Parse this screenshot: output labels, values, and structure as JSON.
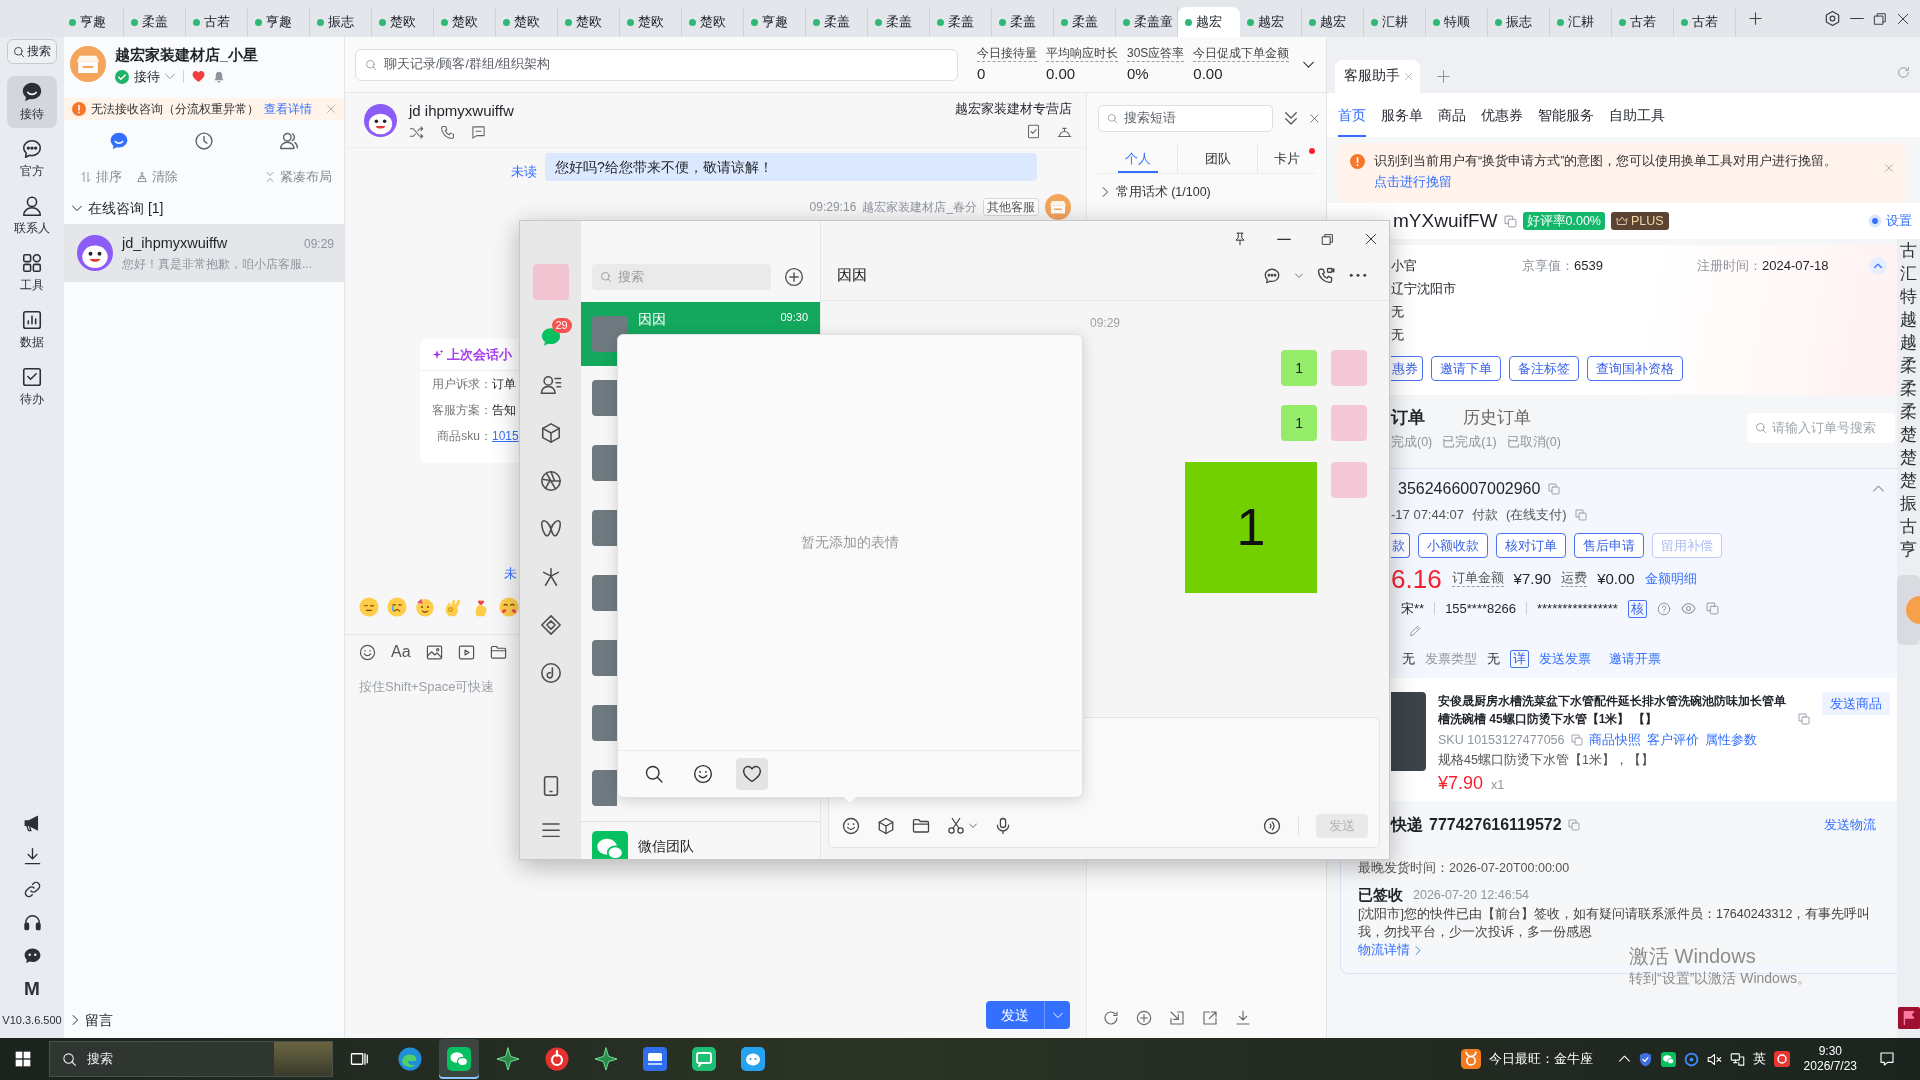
{
  "top_tabs": [
    {
      "label": "亨趣",
      "selected": false
    },
    {
      "label": "柔盖",
      "selected": false
    },
    {
      "label": "古若",
      "selected": false
    },
    {
      "label": "亨趣",
      "selected": false
    },
    {
      "label": "振志",
      "selected": false
    },
    {
      "label": "楚欧",
      "selected": false
    },
    {
      "label": "楚欧",
      "selected": false
    },
    {
      "label": "楚欧",
      "selected": false
    },
    {
      "label": "楚欧",
      "selected": false
    },
    {
      "label": "楚欧",
      "selected": false
    },
    {
      "label": "楚欧",
      "selected": false
    },
    {
      "label": "亨趣",
      "selected": false
    },
    {
      "label": "柔盖",
      "selected": false
    },
    {
      "label": "柔盖",
      "selected": false
    },
    {
      "label": "柔盖",
      "selected": false
    },
    {
      "label": "柔盖",
      "selected": false
    },
    {
      "label": "柔盖",
      "selected": false
    },
    {
      "label": "柔盖童",
      "selected": false
    },
    {
      "label": "越宏",
      "selected": true
    },
    {
      "label": "越宏",
      "selected": false
    },
    {
      "label": "越宏",
      "selected": false
    },
    {
      "label": "汇耕",
      "selected": false
    },
    {
      "label": "特顺",
      "selected": false
    },
    {
      "label": "振志",
      "selected": false
    },
    {
      "label": "汇耕",
      "selected": false
    },
    {
      "label": "古若",
      "selected": false
    },
    {
      "label": "古若",
      "selected": false
    }
  ],
  "nav_rail": {
    "search": "搜索",
    "items": [
      {
        "label": "接待",
        "selected": true
      },
      {
        "label": "官方",
        "selected": false
      },
      {
        "label": "联系人",
        "selected": false
      },
      {
        "label": "工具",
        "selected": false
      },
      {
        "label": "数据",
        "selected": false
      },
      {
        "label": "待办",
        "selected": false
      }
    ],
    "logo": "M",
    "version": "V10.3.6.500"
  },
  "sessions_panel": {
    "shop_name": "越宏家装建材店_小星",
    "status": "接待",
    "alert": {
      "text": "无法接收咨询（分流权重异常）",
      "link": "查看详情"
    },
    "view_tabs": [
      {
        "selected": true
      },
      {
        "selected": false
      },
      {
        "selected": false
      }
    ],
    "actions": [
      "排序",
      "清除",
      "紧凑布局"
    ],
    "groups": [
      {
        "title": "在线咨询 [1]",
        "expanded": true,
        "sessions": [
          {
            "name": "jd_ihpmyxwuiffw",
            "time": "09:29",
            "preview": "您好！真是非常抱歉，咱小店客服...",
            "selected": true
          }
        ]
      },
      {
        "title": "留言",
        "expanded": false
      }
    ]
  },
  "workbench_header": {
    "search_placeholder": "聊天记录/顾客/群组/组织架构",
    "stats": [
      {
        "label": "今日接待量",
        "value": "0"
      },
      {
        "label": "平均响应时长",
        "value": "0.00"
      },
      {
        "label": "30S应答率",
        "value": "0%"
      },
      {
        "label": "今日促成下单金额",
        "value": "0.00"
      }
    ]
  },
  "chat": {
    "customer": "jd ihpmyxwuiffw",
    "store": "越宏家装建材专营店",
    "messages": [
      {
        "kind": "text",
        "status": "未读",
        "text": "您好吗?给您带来不便，敬请谅解！"
      },
      {
        "kind": "meta",
        "time": "09:29:16",
        "sender": "越宏家装建材店_春分",
        "tag": "其他客服"
      },
      {
        "kind": "summary",
        "title": "上次会话小",
        "rows": [
          {
            "label": "用户诉求：",
            "value": "订单",
            "link": false
          },
          {
            "label": "客服方案：",
            "value": "告知",
            "link": false
          },
          {
            "label": "商品sku：",
            "value": "1015",
            "link": true
          }
        ]
      },
      {
        "kind": "status",
        "status": "未"
      }
    ],
    "format_label": "Aa",
    "input_placeholder": "按住Shift+Space可快速",
    "send": "发送"
  },
  "phrases": {
    "search_placeholder": "搜索短语",
    "tabs": [
      {
        "label": "个人",
        "selected": true,
        "dot": false
      },
      {
        "label": "团队",
        "selected": false,
        "dot": false
      },
      {
        "label": "卡片",
        "selected": false,
        "dot": true
      }
    ],
    "groups": [
      {
        "title": "常用话术 (1/100)",
        "expanded": false
      }
    ]
  },
  "assistant": {
    "tabs": [
      {
        "label": "客服助手",
        "selected": true
      }
    ],
    "nav": [
      {
        "label": "首页",
        "selected": true
      },
      {
        "label": "服务单",
        "selected": false
      },
      {
        "label": "商品",
        "selected": false
      },
      {
        "label": "优惠券",
        "selected": false
      },
      {
        "label": "智能服务",
        "selected": false
      },
      {
        "label": "自助工具",
        "selected": false
      }
    ],
    "notice": {
      "text": "识别到当前用户有“换货申请方式”的意图，您可以使用换单工具对用户进行挽留。",
      "link": "点击进行挽留"
    },
    "customer": {
      "name": "mYXwuifFW",
      "rating": "好评率0.00%",
      "member": "PLUS",
      "settings": "设置",
      "expanded": true
    },
    "info_rows": [
      {
        "value": "小官",
        "extras": [
          {
            "label": "京享值：",
            "value": "6539"
          },
          {
            "label": "注册时间：",
            "value": "2024-07-18"
          }
        ]
      },
      {
        "value": "辽宁沈阳市"
      },
      {
        "value": "无"
      },
      {
        "value": "无"
      }
    ],
    "actions": [
      "惠券",
      "邀请下单",
      "备注标签",
      "查询国补资格"
    ],
    "order_tabs": [
      {
        "label": "订单",
        "selected": true
      },
      {
        "label": "历史订单",
        "selected": false
      }
    ],
    "order_filters": [
      "完成(0)",
      "已完成(1)",
      "已取消(0)"
    ],
    "order_search_placeholder": "请输入订单号搜索",
    "order": {
      "id": "3562466007002960",
      "expanded": true,
      "paid_at": "-17 07:44:07",
      "paid_label": "付款",
      "pay_method": "(在线支付)",
      "actions": [
        {
          "label": "款",
          "disabled": false
        },
        {
          "label": "小额收款",
          "disabled": false
        },
        {
          "label": "核对订单",
          "disabled": false
        },
        {
          "label": "售后申请",
          "disabled": false
        },
        {
          "label": "留用补偿",
          "disabled": true
        }
      ],
      "paid_amount": "6.16",
      "total_label": "订单金额",
      "total": "¥7.90",
      "freight_label": "运费",
      "freight": "¥0.00",
      "breakdown_link": "金额明细",
      "receiver": "宋**",
      "phone": "155****8266",
      "address": "****************",
      "verify": "核",
      "invoice": "无",
      "invoice_type_label": "发票类型",
      "invoice_type": "无",
      "invoice_detail": "详",
      "send_invoice": "发送发票",
      "invite_invoice": "邀请开票"
    },
    "product": {
      "title": "安俊晟厨房水槽洗菜盆下水管配件延长排水管洗碗池防味加长管单槽洗碗槽 45螺口防烫下水管【1米】 【】",
      "send": "发送商品",
      "sku": "SKU 10153127477056",
      "links": [
        "商品快照",
        "客户评价",
        "属性参数"
      ],
      "spec": "规格45螺口防烫下水管【1米】，【】",
      "price": "¥7.90",
      "quantity": "x1"
    },
    "logistics": {
      "carrier": "快递",
      "tracking_no": "777427616119572",
      "send": "发送物流",
      "deadline_label": "最晚发货时间：",
      "deadline": "2026-07-20T00:00:00",
      "status": "已签收",
      "status_time": "2026-07-20 12:46:54",
      "detail": "[沈阳市]您的快件已由【前台】签收，如有疑问请联系派件员：17640243312，有事先呼叫我，勿找平台，少一次投诉，多一份感恩",
      "detail_link": "物流详情"
    }
  },
  "side_tabs": [
    "古",
    "汇",
    "特",
    "越",
    "越",
    "柔",
    "柔",
    "柔",
    "楚",
    "楚",
    "楚",
    "振",
    "古",
    "亨"
  ],
  "activation_notice": {
    "title": "激活 Windows",
    "hint": "转到“设置”以激活 Windows。"
  },
  "wechat": {
    "unread": "29",
    "nav": [
      {
        "selected": true
      },
      {
        "selected": false
      },
      {
        "selected": false
      },
      {
        "selected": false
      },
      {
        "selected": false
      },
      {
        "selected": false
      },
      {
        "selected": false
      },
      {
        "selected": false
      }
    ],
    "search_placeholder": "搜索",
    "contacts": [
      {
        "kind": "photo",
        "name": "因因",
        "time": "09:30",
        "selected": true
      },
      {
        "kind": "photo",
        "selected": false
      },
      {
        "kind": "photo",
        "selected": false
      },
      {
        "kind": "photo",
        "selected": false
      },
      {
        "kind": "photo",
        "selected": false
      },
      {
        "kind": "photo",
        "selected": false
      },
      {
        "kind": "photo",
        "selected": false
      },
      {
        "kind": "photo",
        "selected": false
      },
      {
        "kind": "official",
        "name": "微信团队",
        "selected": false
      }
    ],
    "chat_title": "因因",
    "timestamp": "09:29",
    "messages": [
      {
        "kind": "text",
        "text": "1"
      },
      {
        "kind": "text",
        "text": "1"
      },
      {
        "kind": "image",
        "text": "1"
      }
    ],
    "send": {
      "label": "发送",
      "disabled": true
    },
    "sticker_panel": {
      "empty_text": "暂无添加的表情",
      "tabs": [
        {
          "selected": false
        },
        {
          "selected": false
        },
        {
          "selected": true
        }
      ]
    }
  },
  "taskbar": {
    "search": "搜索",
    "apps": [
      {
        "selected": false
      },
      {
        "selected": true
      },
      {
        "selected": false
      },
      {
        "selected": false
      },
      {
        "selected": false
      },
      {
        "selected": false
      },
      {
        "selected": false
      },
      {
        "selected": false
      }
    ],
    "widget": "今日最旺：金牛座",
    "ime": "英",
    "time": "9:30",
    "date": "2026/7/23"
  }
}
